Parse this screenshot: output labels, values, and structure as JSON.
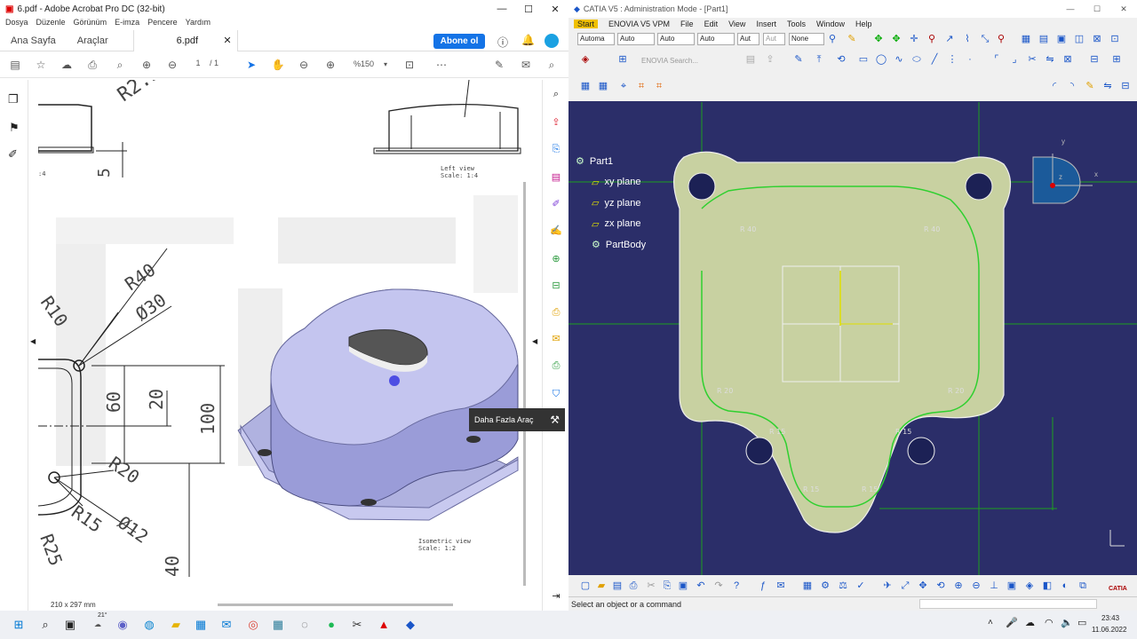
{
  "acrobat": {
    "title": "6.pdf - Adobe Acrobat Pro DC (32-bit)",
    "menu": [
      "Dosya",
      "Düzenle",
      "Görünüm",
      "E-imza",
      "Pencere",
      "Yardım"
    ],
    "tabs": {
      "home": "Ana Sayfa",
      "tools": "Araçlar",
      "doc": "6.pdf"
    },
    "subscribe": "Abone ol",
    "page_current": "1",
    "page_total": "/ 1",
    "zoom": "%150",
    "tooltip": "Daha Fazla Araç",
    "page_size": "210 x 297 mm",
    "drawing": {
      "left_view": "Left view",
      "left_scale": "Scale:  1:4",
      "iso_view": "Isometric view",
      "iso_scale": "Scale:  1:2",
      "dims": [
        "R2.5",
        "5",
        "R40",
        "Ø30",
        "R10",
        "60",
        "20",
        "100",
        "R20",
        "Ø12",
        "R15",
        "R25",
        "40"
      ],
      "small_left": ":4"
    }
  },
  "catia": {
    "title": "CATIA V5 : Administration Mode - [Part1]",
    "menu": [
      "Start",
      "ENOVIA V5 VPM",
      "File",
      "Edit",
      "View",
      "Insert",
      "Tools",
      "Window",
      "Help"
    ],
    "selects": [
      "Automa",
      "Auto",
      "Auto",
      "Auto",
      "Aut",
      "Aut",
      "None"
    ],
    "enovia_search": "ENOVIA Search...",
    "tree": {
      "root": "Part1",
      "xy": "xy plane",
      "yz": "yz plane",
      "zx": "zx plane",
      "body": "PartBody"
    },
    "sketch_labels": [
      "R 40",
      "R 40",
      "R 20",
      "R 20",
      "R 15",
      "R 15",
      "R 15",
      "R 15"
    ],
    "axis": {
      "x": "x",
      "y": "y",
      "z": "z"
    },
    "status": "Select an object or a command",
    "brand": "CATIA"
  },
  "taskbar": {
    "temp": "21°",
    "time": "23:43",
    "date": "11.06.2022"
  },
  "colors": {
    "catia_bg": "#2b2e69",
    "sketch_fill": "#c8d1a1",
    "sketch_line": "#2fd02f",
    "acrobat_blue": "#1473e6",
    "tooltip_bg": "#333333"
  }
}
